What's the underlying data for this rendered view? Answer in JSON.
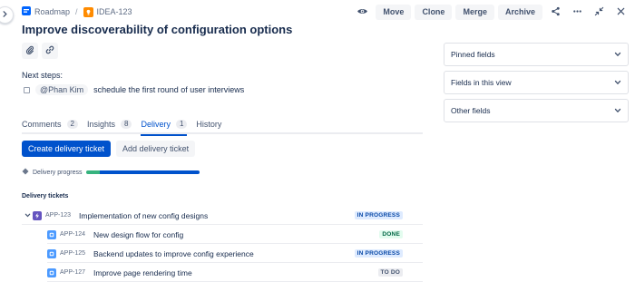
{
  "breadcrumb": {
    "project": "Roadmap",
    "separator": "/",
    "issue_key": "IDEA-123"
  },
  "actions": {
    "move": "Move",
    "clone": "Clone",
    "merge": "Merge",
    "archive": "Archive"
  },
  "issue": {
    "title": "Improve discoverability of configuration options"
  },
  "next_steps": {
    "heading": "Next steps:",
    "task": {
      "mention": "@Phan Kim",
      "text": "schedule the first round of user interviews"
    }
  },
  "tabs": [
    {
      "label": "Comments",
      "count": "2"
    },
    {
      "label": "Insights",
      "count": "8"
    },
    {
      "label": "Delivery",
      "count": "1",
      "active": true
    },
    {
      "label": "History"
    }
  ],
  "delivery": {
    "create_button": "Create delivery ticket",
    "add_button": "Add delivery ticket",
    "progress_label": "Delivery progress",
    "progress": {
      "done": 0.12,
      "in_progress": 0.88
    },
    "tickets_heading": "Delivery tickets",
    "tickets": [
      {
        "key": "APP-123",
        "summary": "Implementation of new config designs",
        "status": "IN PROGRESS",
        "type": "epic"
      },
      {
        "key": "APP-124",
        "summary": "New design flow for config",
        "status": "DONE",
        "type": "task"
      },
      {
        "key": "APP-125",
        "summary": "Backend updates to improve config experience",
        "status": "IN PROGRESS",
        "type": "task"
      },
      {
        "key": "APP-127",
        "summary": "Improve page rendering time",
        "status": "TO DO",
        "type": "task"
      }
    ]
  },
  "side_panels": [
    {
      "label": "Pinned fields"
    },
    {
      "label": "Fields in this view"
    },
    {
      "label": "Other fields"
    }
  ],
  "colors": {
    "accent": "#0052cc",
    "done": "#36b37e",
    "idea": "#ff8b00",
    "epic": "#6554c0",
    "task": "#4c9aff"
  }
}
